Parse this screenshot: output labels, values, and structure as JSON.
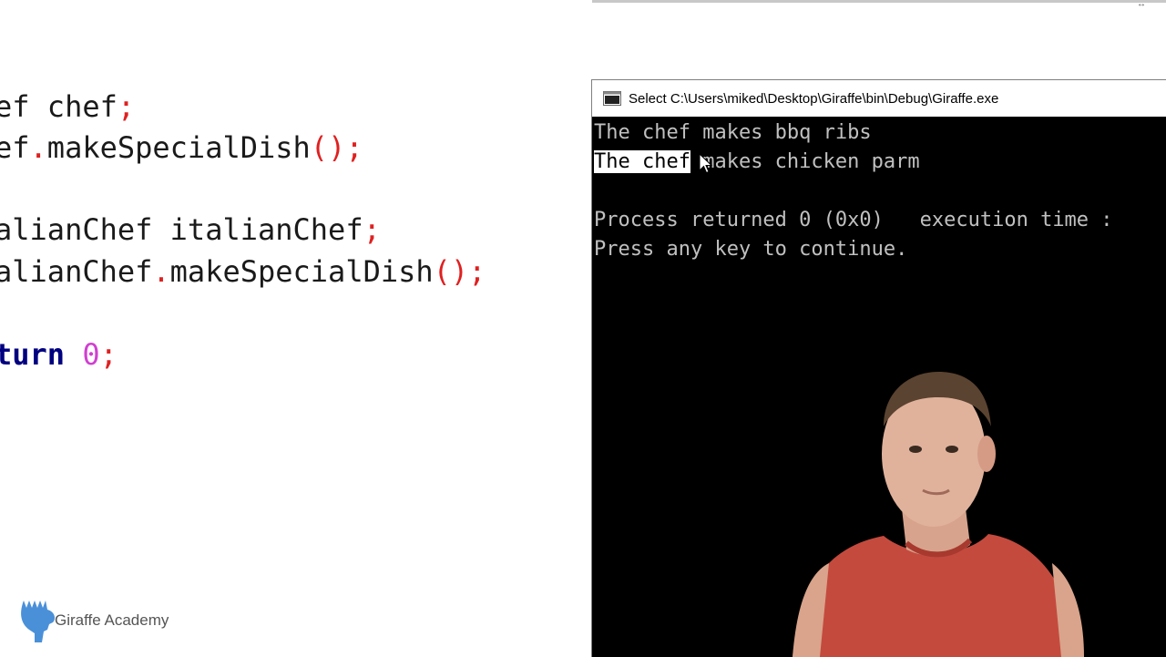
{
  "editor": {
    "lines": [
      {
        "a": "ef chef",
        "b": ";"
      },
      {
        "a": "ef",
        "b": ".",
        "c": "makeSpecialDish",
        "d": "();"
      },
      {
        "a": "alianChef italianChef",
        "b": ";"
      },
      {
        "a": "alianChef",
        "b": ".",
        "c": "makeSpecialDish",
        "d": "();"
      },
      {
        "kw": "turn",
        "num": "0",
        "b": ";"
      }
    ]
  },
  "console": {
    "title": "Select C:\\Users\\miked\\Desktop\\Giraffe\\bin\\Debug\\Giraffe.exe",
    "line1": "The chef makes bbq ribs",
    "line2_selected": "The chef",
    "line2_rest": " makes chicken parm",
    "line3": "Process returned 0 (0x0)   execution time :",
    "line4": "Press any key to continue."
  },
  "branding": {
    "label": "Giraffe Academy",
    "logo_icon": "giraffe-logo-icon",
    "color": "#4a90d9"
  }
}
